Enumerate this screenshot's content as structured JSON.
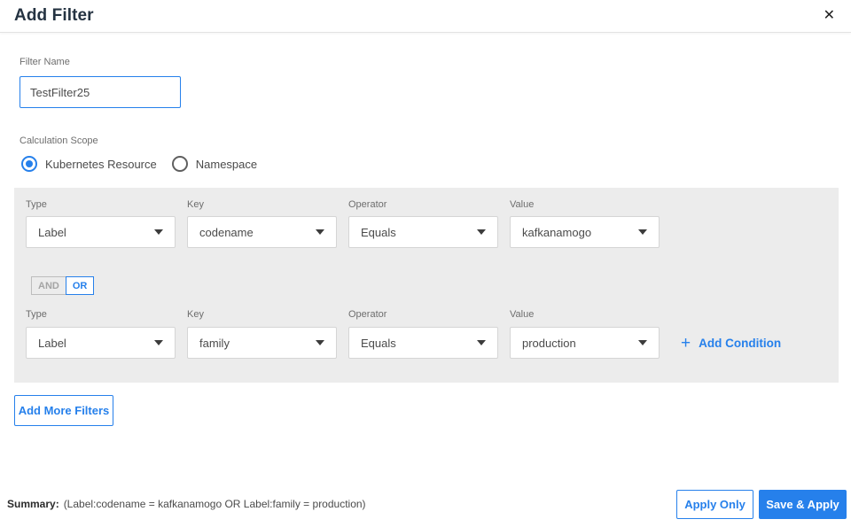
{
  "header": {
    "title": "Add Filter",
    "close_icon": "✕"
  },
  "filter_name": {
    "label": "Filter Name",
    "value": "TestFilter25"
  },
  "calculation_scope": {
    "label": "Calculation Scope",
    "options": [
      {
        "label": "Kubernetes Resource",
        "selected": true
      },
      {
        "label": "Namespace",
        "selected": false
      }
    ]
  },
  "conditions": {
    "column_labels": [
      "Type",
      "Key",
      "Operator",
      "Value"
    ],
    "rows": [
      {
        "type": "Label",
        "key": "codename",
        "operator": "Equals",
        "value": "kafkanamogo"
      },
      {
        "type": "Label",
        "key": "family",
        "operator": "Equals",
        "value": "production"
      }
    ],
    "logic_toggle": {
      "and_label": "AND",
      "or_label": "OR",
      "selected": "OR"
    },
    "add_condition": {
      "plus_icon": "+",
      "label": "Add Condition"
    }
  },
  "add_more_filters_label": "Add More Filters",
  "footer": {
    "summary_label": "Summary:",
    "summary_text": "(Label:codename = kafkanamogo OR Label:family = production)",
    "apply_only_label": "Apply Only",
    "save_apply_label": "Save & Apply"
  },
  "colors": {
    "accent": "#2680eb",
    "panel_background": "#ececec",
    "heading_text": "#253342"
  }
}
